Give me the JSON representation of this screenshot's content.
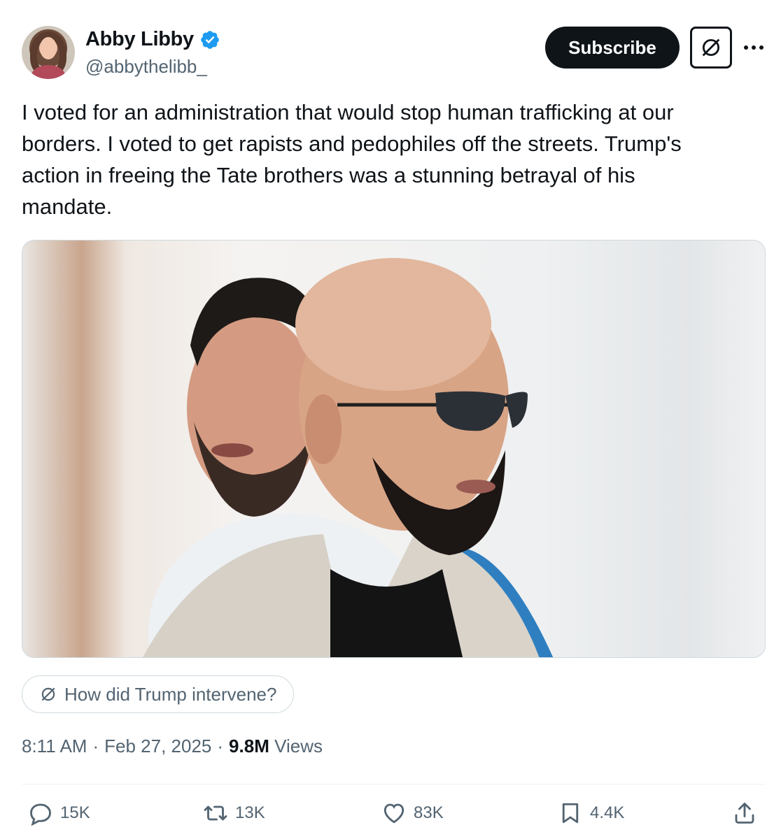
{
  "author": {
    "display_name": "Abby Libby",
    "handle": "@abbythelibb_",
    "verified_color": "#1d9bf0"
  },
  "header": {
    "subscribe_label": "Subscribe",
    "grok_icon": "grok-icon",
    "more_icon": "more-dots-icon"
  },
  "tweet": {
    "text": "I voted for an administration that would stop human trafficking at our\nborders. I voted to get rapists and pedophiles off the streets. Trump's\naction in freeing the Tate brothers was a stunning betrayal of his\nmandate."
  },
  "grok_prompt": {
    "label": "How did Trump intervene?"
  },
  "meta": {
    "time": "8:11 AM",
    "separator": "·",
    "date": "Feb 27, 2025",
    "views_count": "9.8M",
    "views_label": "Views"
  },
  "actions": {
    "replies": "15K",
    "reposts": "13K",
    "likes": "83K",
    "bookmarks": "4.4K"
  },
  "colors": {
    "text_primary": "#0f1419",
    "text_secondary": "#536471",
    "border": "#cfd9de",
    "accent": "#1d9bf0"
  }
}
